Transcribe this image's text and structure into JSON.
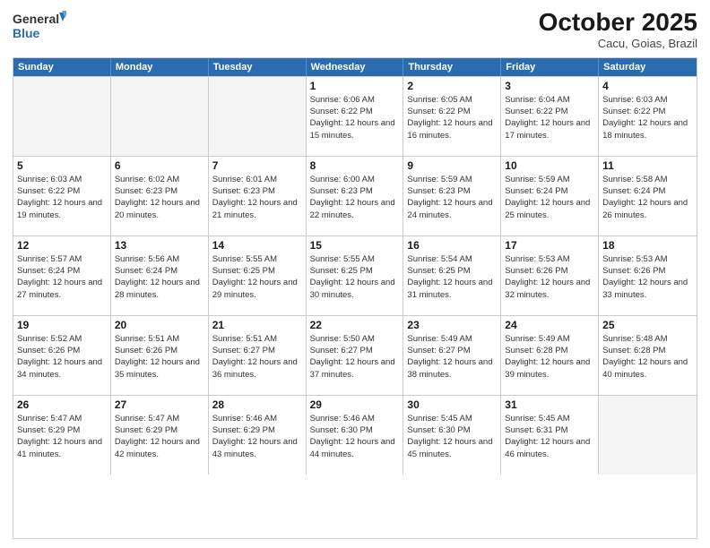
{
  "header": {
    "logo_general": "General",
    "logo_blue": "Blue",
    "title": "October 2025",
    "subtitle": "Cacu, Goias, Brazil"
  },
  "days_of_week": [
    "Sunday",
    "Monday",
    "Tuesday",
    "Wednesday",
    "Thursday",
    "Friday",
    "Saturday"
  ],
  "weeks": [
    [
      {
        "day": "",
        "info": "",
        "empty": true
      },
      {
        "day": "",
        "info": "",
        "empty": true
      },
      {
        "day": "",
        "info": "",
        "empty": true
      },
      {
        "day": "1",
        "info": "Sunrise: 6:06 AM\nSunset: 6:22 PM\nDaylight: 12 hours\nand 15 minutes.",
        "empty": false
      },
      {
        "day": "2",
        "info": "Sunrise: 6:05 AM\nSunset: 6:22 PM\nDaylight: 12 hours\nand 16 minutes.",
        "empty": false
      },
      {
        "day": "3",
        "info": "Sunrise: 6:04 AM\nSunset: 6:22 PM\nDaylight: 12 hours\nand 17 minutes.",
        "empty": false
      },
      {
        "day": "4",
        "info": "Sunrise: 6:03 AM\nSunset: 6:22 PM\nDaylight: 12 hours\nand 18 minutes.",
        "empty": false
      }
    ],
    [
      {
        "day": "5",
        "info": "Sunrise: 6:03 AM\nSunset: 6:22 PM\nDaylight: 12 hours\nand 19 minutes.",
        "empty": false
      },
      {
        "day": "6",
        "info": "Sunrise: 6:02 AM\nSunset: 6:23 PM\nDaylight: 12 hours\nand 20 minutes.",
        "empty": false
      },
      {
        "day": "7",
        "info": "Sunrise: 6:01 AM\nSunset: 6:23 PM\nDaylight: 12 hours\nand 21 minutes.",
        "empty": false
      },
      {
        "day": "8",
        "info": "Sunrise: 6:00 AM\nSunset: 6:23 PM\nDaylight: 12 hours\nand 22 minutes.",
        "empty": false
      },
      {
        "day": "9",
        "info": "Sunrise: 5:59 AM\nSunset: 6:23 PM\nDaylight: 12 hours\nand 24 minutes.",
        "empty": false
      },
      {
        "day": "10",
        "info": "Sunrise: 5:59 AM\nSunset: 6:24 PM\nDaylight: 12 hours\nand 25 minutes.",
        "empty": false
      },
      {
        "day": "11",
        "info": "Sunrise: 5:58 AM\nSunset: 6:24 PM\nDaylight: 12 hours\nand 26 minutes.",
        "empty": false
      }
    ],
    [
      {
        "day": "12",
        "info": "Sunrise: 5:57 AM\nSunset: 6:24 PM\nDaylight: 12 hours\nand 27 minutes.",
        "empty": false
      },
      {
        "day": "13",
        "info": "Sunrise: 5:56 AM\nSunset: 6:24 PM\nDaylight: 12 hours\nand 28 minutes.",
        "empty": false
      },
      {
        "day": "14",
        "info": "Sunrise: 5:55 AM\nSunset: 6:25 PM\nDaylight: 12 hours\nand 29 minutes.",
        "empty": false
      },
      {
        "day": "15",
        "info": "Sunrise: 5:55 AM\nSunset: 6:25 PM\nDaylight: 12 hours\nand 30 minutes.",
        "empty": false
      },
      {
        "day": "16",
        "info": "Sunrise: 5:54 AM\nSunset: 6:25 PM\nDaylight: 12 hours\nand 31 minutes.",
        "empty": false
      },
      {
        "day": "17",
        "info": "Sunrise: 5:53 AM\nSunset: 6:26 PM\nDaylight: 12 hours\nand 32 minutes.",
        "empty": false
      },
      {
        "day": "18",
        "info": "Sunrise: 5:53 AM\nSunset: 6:26 PM\nDaylight: 12 hours\nand 33 minutes.",
        "empty": false
      }
    ],
    [
      {
        "day": "19",
        "info": "Sunrise: 5:52 AM\nSunset: 6:26 PM\nDaylight: 12 hours\nand 34 minutes.",
        "empty": false
      },
      {
        "day": "20",
        "info": "Sunrise: 5:51 AM\nSunset: 6:26 PM\nDaylight: 12 hours\nand 35 minutes.",
        "empty": false
      },
      {
        "day": "21",
        "info": "Sunrise: 5:51 AM\nSunset: 6:27 PM\nDaylight: 12 hours\nand 36 minutes.",
        "empty": false
      },
      {
        "day": "22",
        "info": "Sunrise: 5:50 AM\nSunset: 6:27 PM\nDaylight: 12 hours\nand 37 minutes.",
        "empty": false
      },
      {
        "day": "23",
        "info": "Sunrise: 5:49 AM\nSunset: 6:27 PM\nDaylight: 12 hours\nand 38 minutes.",
        "empty": false
      },
      {
        "day": "24",
        "info": "Sunrise: 5:49 AM\nSunset: 6:28 PM\nDaylight: 12 hours\nand 39 minutes.",
        "empty": false
      },
      {
        "day": "25",
        "info": "Sunrise: 5:48 AM\nSunset: 6:28 PM\nDaylight: 12 hours\nand 40 minutes.",
        "empty": false
      }
    ],
    [
      {
        "day": "26",
        "info": "Sunrise: 5:47 AM\nSunset: 6:29 PM\nDaylight: 12 hours\nand 41 minutes.",
        "empty": false
      },
      {
        "day": "27",
        "info": "Sunrise: 5:47 AM\nSunset: 6:29 PM\nDaylight: 12 hours\nand 42 minutes.",
        "empty": false
      },
      {
        "day": "28",
        "info": "Sunrise: 5:46 AM\nSunset: 6:29 PM\nDaylight: 12 hours\nand 43 minutes.",
        "empty": false
      },
      {
        "day": "29",
        "info": "Sunrise: 5:46 AM\nSunset: 6:30 PM\nDaylight: 12 hours\nand 44 minutes.",
        "empty": false
      },
      {
        "day": "30",
        "info": "Sunrise: 5:45 AM\nSunset: 6:30 PM\nDaylight: 12 hours\nand 45 minutes.",
        "empty": false
      },
      {
        "day": "31",
        "info": "Sunrise: 5:45 AM\nSunset: 6:31 PM\nDaylight: 12 hours\nand 46 minutes.",
        "empty": false
      },
      {
        "day": "",
        "info": "",
        "empty": true
      }
    ]
  ]
}
